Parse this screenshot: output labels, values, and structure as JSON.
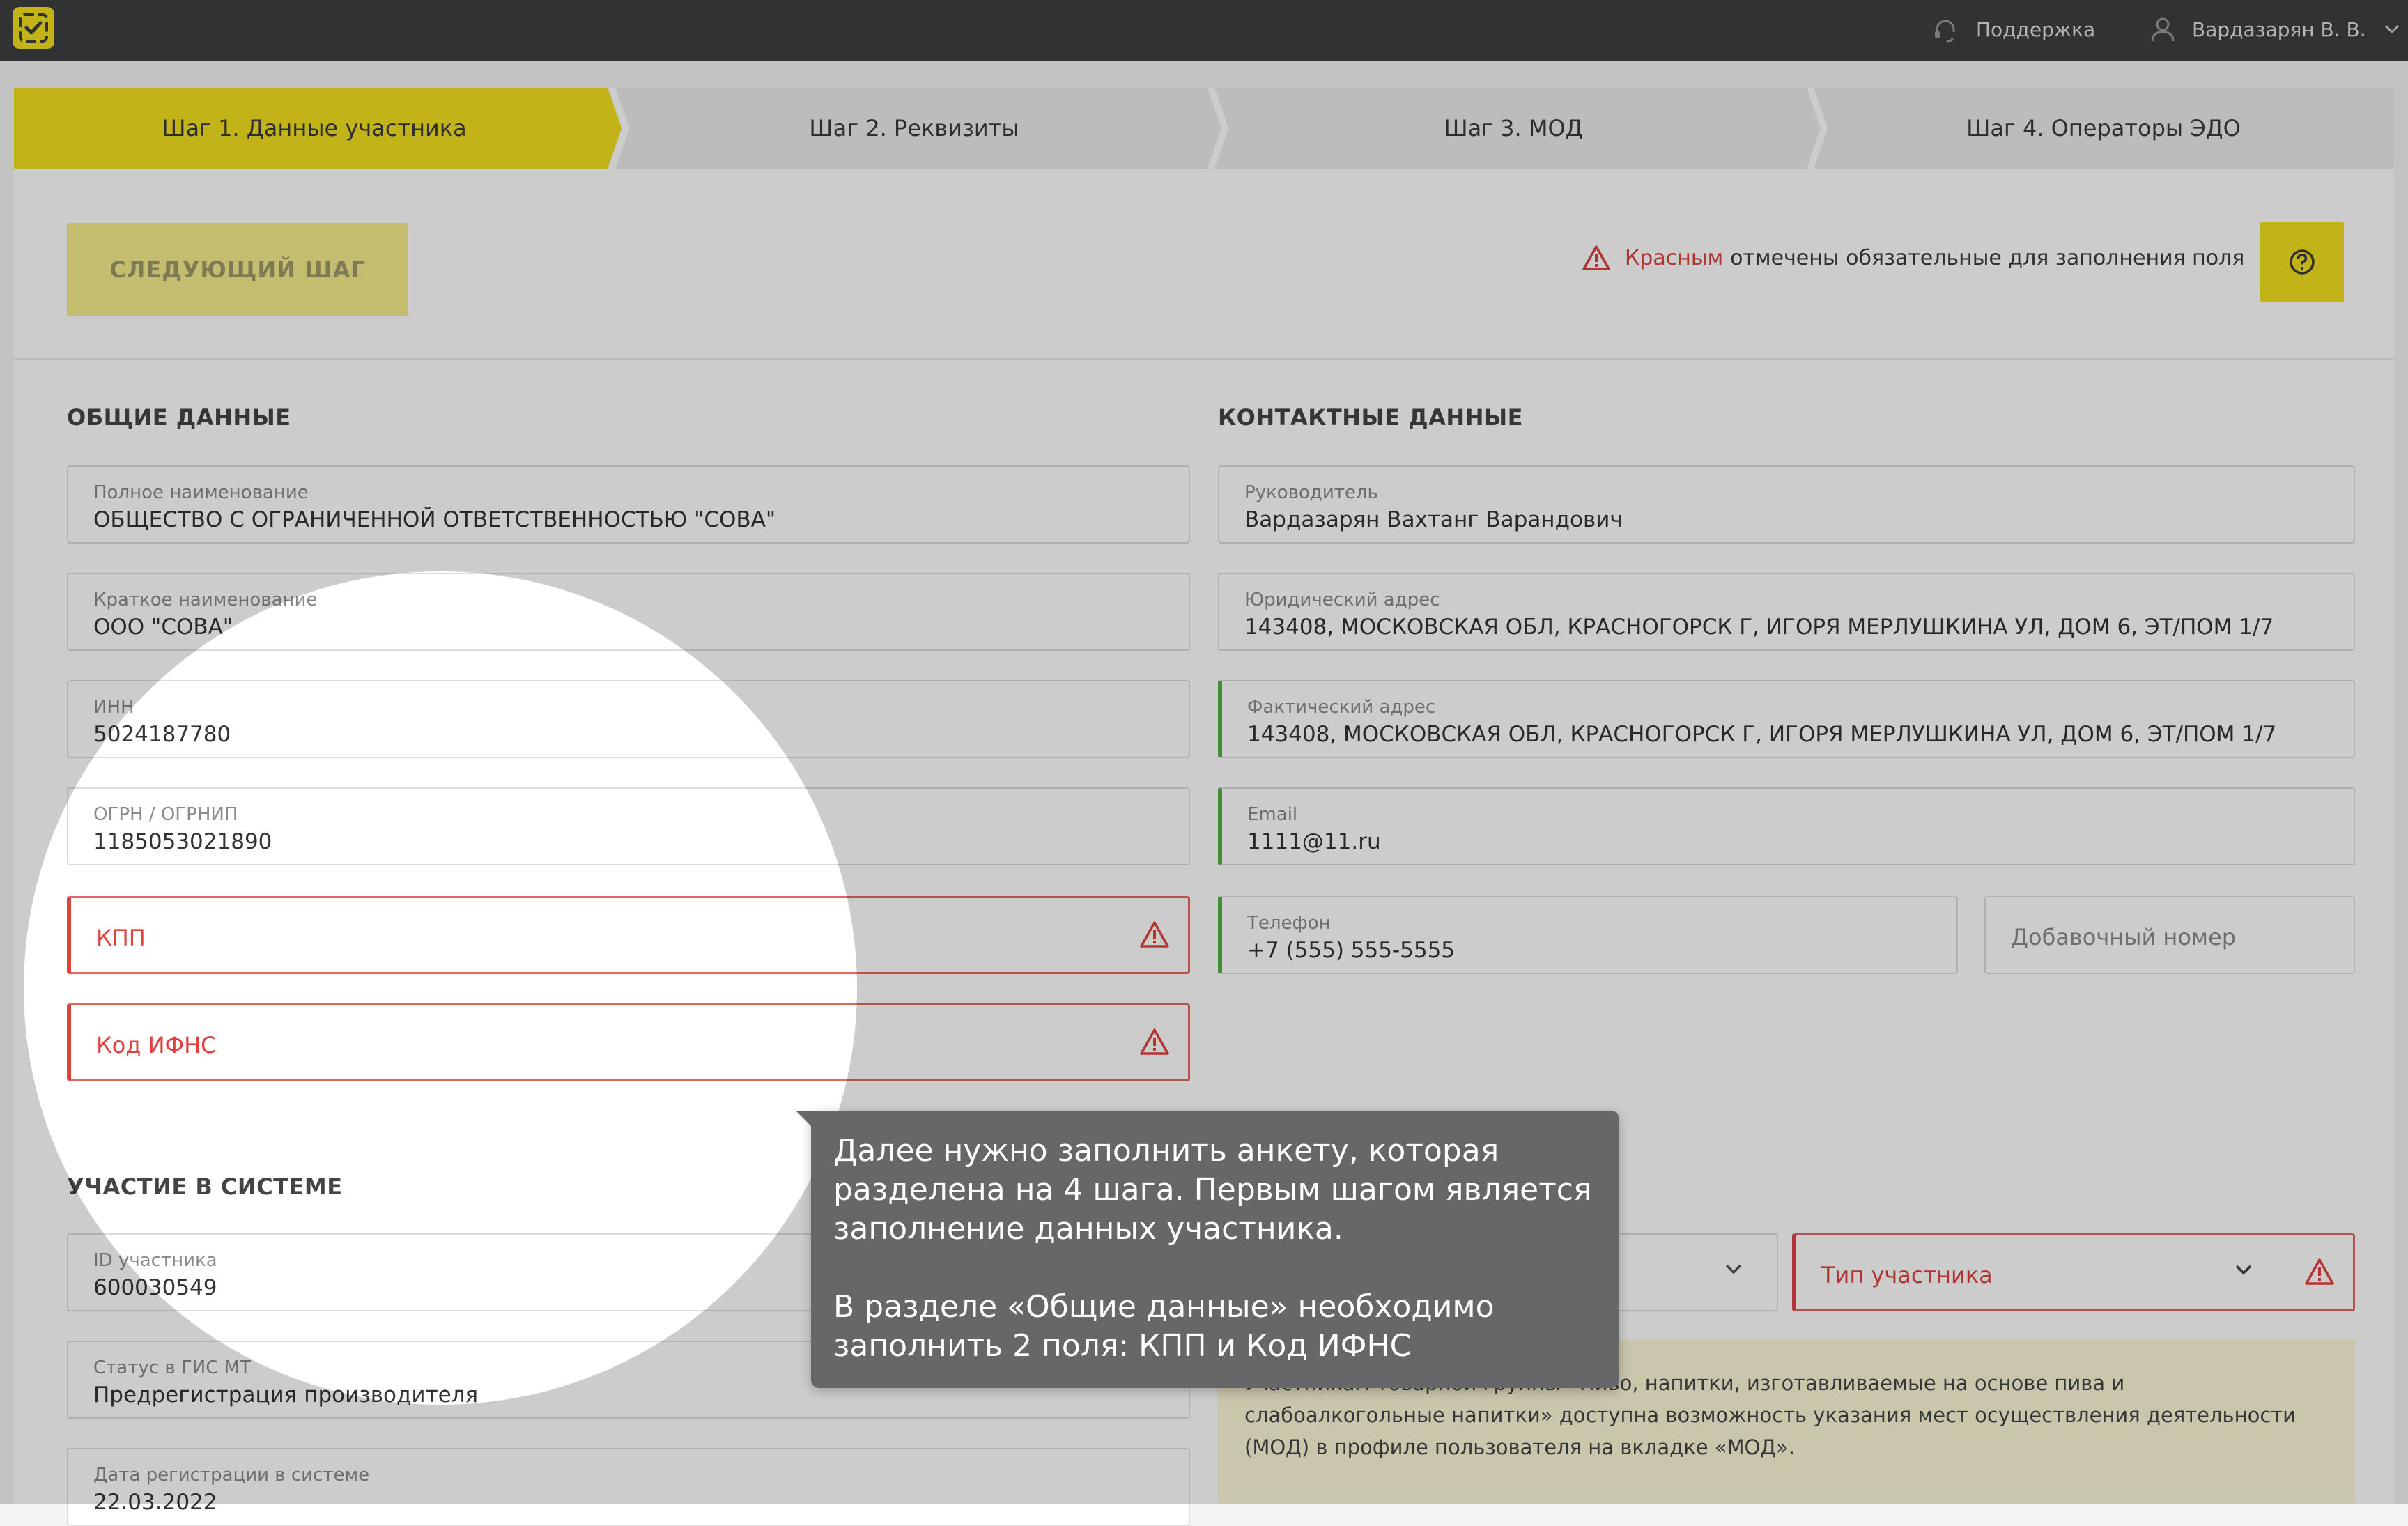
{
  "header": {
    "support_label": "Поддержка",
    "user_name": "Вардазарян В. В."
  },
  "steps": [
    {
      "label": "Шаг 1. Данные участника",
      "active": true
    },
    {
      "label": "Шаг 2. Реквизиты",
      "active": false
    },
    {
      "label": "Шаг 3. МОД",
      "active": false
    },
    {
      "label": "Шаг 4. Операторы ЭДО",
      "active": false
    }
  ],
  "toolbar": {
    "next_label": "СЛЕДУЮЩИЙ ШАГ",
    "required_red": "Красным",
    "required_rest": "отмечены обязательные для заполнения поля"
  },
  "general": {
    "title": "ОБЩИЕ ДАННЫЕ",
    "full_name": {
      "label": "Полное наименование",
      "value": "ОБЩЕСТВО С ОГРАНИЧЕННОЙ ОТВЕТСТВЕННОСТЬЮ \"СОВА\""
    },
    "short_name": {
      "label": "Краткое наименование",
      "value": "ООО \"СОВА\""
    },
    "inn": {
      "label": "ИНН",
      "value": "5024187780"
    },
    "ogrn": {
      "label": "ОГРН / ОГРНИП",
      "value": "1185053021890"
    },
    "kpp": {
      "placeholder": "КПП"
    },
    "ifns": {
      "placeholder": "Код ИФНС"
    }
  },
  "contacts": {
    "title": "КОНТАКТНЫЕ ДАННЫЕ",
    "head": {
      "label": "Руководитель",
      "value": "Вардазарян Вахтанг Варандович"
    },
    "legal_address": {
      "label": "Юридический адрес",
      "value": "143408, МОСКОВСКАЯ ОБЛ, КРАСНОГОРСК Г, ИГОРЯ МЕРЛУШКИНА УЛ, ДОМ 6, ЭТ/ПОМ 1/7"
    },
    "actual_address": {
      "label": "Фактический адрес",
      "value": "143408, МОСКОВСКАЯ ОБЛ, КРАСНОГОРСК Г, ИГОРЯ МЕРЛУШКИНА УЛ, ДОМ 6, ЭТ/ПОМ 1/7"
    },
    "email": {
      "label": "Email",
      "value": "1111@11.ru"
    },
    "phone": {
      "label": "Телефон",
      "value": "+7 (555) 555-5555"
    },
    "extension": {
      "placeholder": "Добавочный номер"
    }
  },
  "participation": {
    "title": "УЧАСТИЕ В СИСТЕМЕ",
    "id": {
      "label": "ID участника",
      "value": "600030549"
    },
    "status": {
      "label": "Статус в ГИС МТ",
      "value": "Предрегистрация производителя"
    },
    "reg_date": {
      "label": "Дата регистрации в системе",
      "value": "22.03.2022"
    },
    "participant_type": {
      "placeholder": "Тип участника"
    },
    "info": "Участникам товарной группы «Пиво, напитки, изготавливаемые на основе пива и слабоалкогольные напитки» доступна возможность указания мест осуществления деятельности (МОД) в профиле пользователя на вкладке «МОД»."
  },
  "tooltip": {
    "p1": "Далее нужно заполнить анкету, которая разделена на 4 шага. Первым шагом является заполнение данных участника.",
    "p2": "В разделе «Общие данные» необходимо заполнить 2 поля: КПП и Код ИФНС"
  },
  "colors": {
    "accent_yellow": "#f3e11f",
    "error_red": "#e0413c",
    "ok_green": "#55b045",
    "topbar": "#3d3f42"
  }
}
